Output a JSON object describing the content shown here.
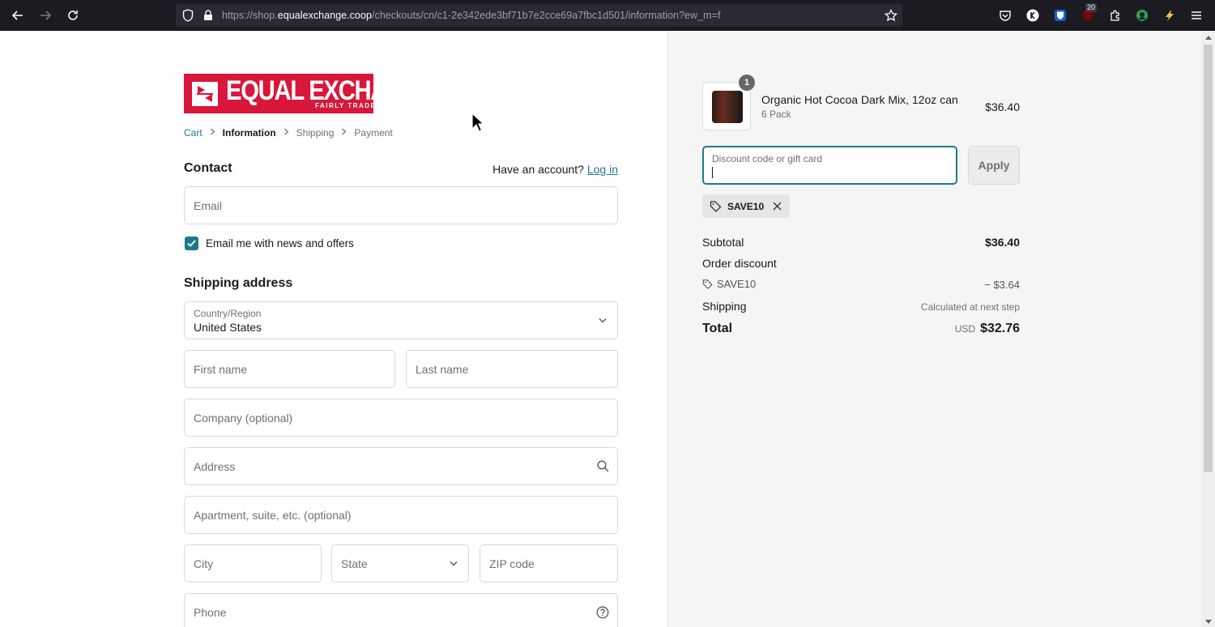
{
  "browser": {
    "url_prefix": "https://shop.",
    "url_host": "equalexchange.coop",
    "url_path": "/checkouts/cn/c1-2e342ede3bf71b7e2cce69a7fbc1d501/information?ew_m=f",
    "ext_badge_count": "20"
  },
  "logo": {
    "name": "EQUAL EXCHANGE",
    "tagline": "FAIRLY TRADED"
  },
  "breadcrumb": {
    "cart": "Cart",
    "information": "Information",
    "shipping": "Shipping",
    "payment": "Payment"
  },
  "contact": {
    "heading": "Contact",
    "account_prompt": "Have an account?",
    "login_link": "Log in",
    "email_placeholder": "Email",
    "newsletter_label": "Email me with news and offers",
    "newsletter_checked": true
  },
  "shipping_address": {
    "heading": "Shipping address",
    "country_label": "Country/Region",
    "country_value": "United States",
    "first_name_placeholder": "First name",
    "last_name_placeholder": "Last name",
    "company_placeholder": "Company (optional)",
    "address_placeholder": "Address",
    "apartment_placeholder": "Apartment, suite, etc. (optional)",
    "city_placeholder": "City",
    "state_placeholder": "State",
    "zip_placeholder": "ZIP code",
    "phone_placeholder": "Phone"
  },
  "order": {
    "item": {
      "quantity": "1",
      "name": "Organic Hot Cocoa Dark Mix, 12oz can",
      "variant": "6 Pack",
      "price": "$36.40"
    },
    "discount_label": "Discount code or gift card",
    "apply_label": "Apply",
    "applied_code": "SAVE10",
    "subtotal_label": "Subtotal",
    "subtotal_value": "$36.40",
    "order_discount_label": "Order discount",
    "discount_code": "SAVE10",
    "discount_value": "− $3.64",
    "shipping_label": "Shipping",
    "shipping_value": "Calculated at next step",
    "total_label": "Total",
    "currency": "USD",
    "total_value": "$32.76"
  }
}
